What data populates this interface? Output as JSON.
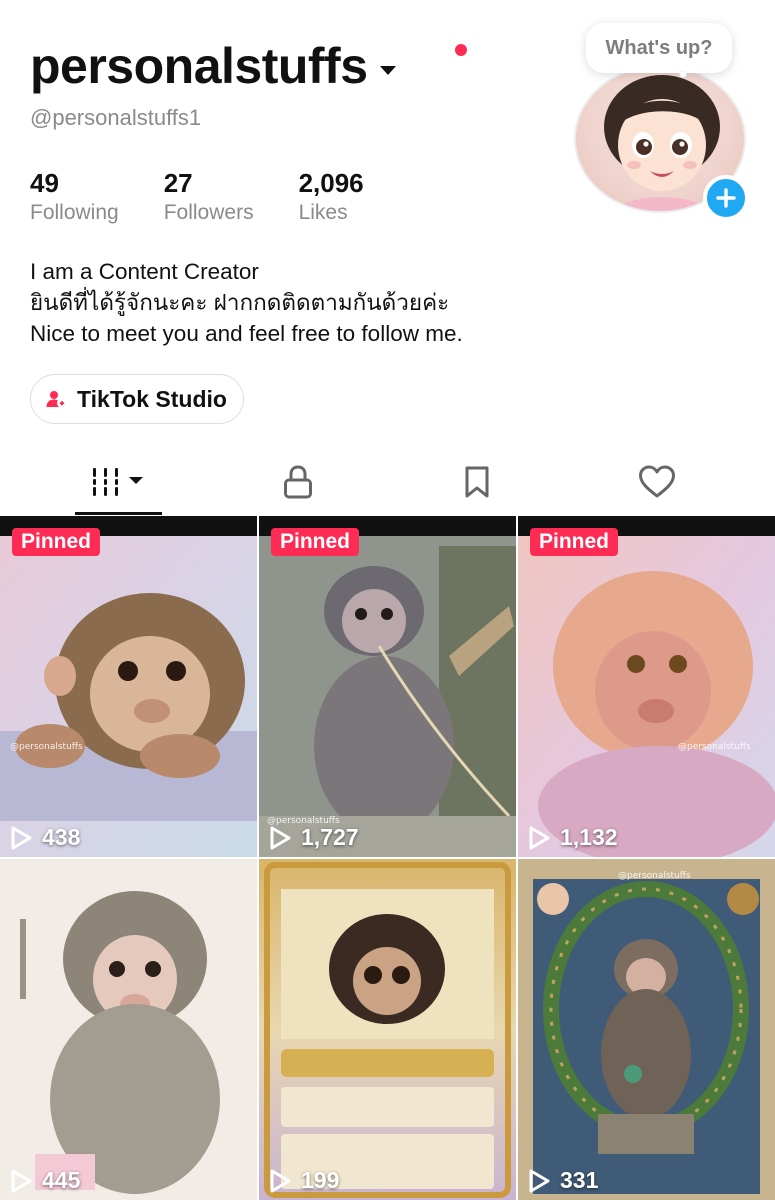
{
  "profile": {
    "display_name": "personalstuffs",
    "handle": "@personalstuffs1",
    "bubble_text": "What's up?",
    "stats": [
      {
        "value": "49",
        "label": "Following"
      },
      {
        "value": "27",
        "label": "Followers"
      },
      {
        "value": "2,096",
        "label": "Likes"
      }
    ],
    "bio": [
      "I am a Content Creator",
      "ยินดีที่ได้รู้จักนะคะ ฝากกดติดตามกันด้วยค่ะ",
      "Nice to meet you and feel free to follow me."
    ],
    "studio_button": "TikTok Studio"
  },
  "tabs": [
    {
      "icon": "grid-icon",
      "active": true
    },
    {
      "icon": "lock-icon",
      "active": false
    },
    {
      "icon": "bookmark-icon",
      "active": false
    },
    {
      "icon": "heart-icon",
      "active": false
    }
  ],
  "videos": [
    {
      "pinned": "Pinned",
      "views": "438",
      "watermark": "@personalstuffs"
    },
    {
      "pinned": "Pinned",
      "views": "1,727",
      "watermark": "@personalstuffs"
    },
    {
      "pinned": "Pinned",
      "views": "1,132",
      "watermark": "@personalstuffs"
    },
    {
      "views": "445"
    },
    {
      "views": "199"
    },
    {
      "views": "331",
      "watermark": "@personalstuffs"
    }
  ],
  "colors": {
    "accent_red": "#fe2c55",
    "plus_blue": "#20a9f2",
    "muted_text": "#8a8a8a"
  }
}
